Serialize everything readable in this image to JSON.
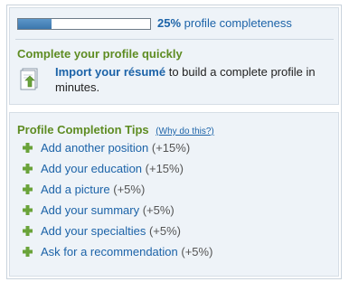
{
  "colors": {
    "link": "#1c63a8",
    "heading_green": "#5e8c22",
    "plus_green": "#6aa33a",
    "panel_bg": "#eef3f8",
    "progress_fill": "#3b77ad"
  },
  "progress": {
    "value_percent": 25,
    "percent_label": "25%",
    "suffix": "profile completeness"
  },
  "complete_profile": {
    "heading": "Complete your profile quickly",
    "link_text": "Import your résumé",
    "body_text": " to build a complete profile in minutes.",
    "icon": "import-resume-icon"
  },
  "tips": {
    "heading": "Profile Completion Tips",
    "why_link": "(Why do this?)",
    "icon": "plus-icon",
    "items": [
      {
        "label": "Add another position",
        "pct": "(+15%)"
      },
      {
        "label": "Add your education",
        "pct": "(+15%)"
      },
      {
        "label": "Add a picture",
        "pct": "(+5%)"
      },
      {
        "label": "Add your summary",
        "pct": "(+5%)"
      },
      {
        "label": "Add your specialties",
        "pct": "(+5%)"
      },
      {
        "label": "Ask for a recommendation",
        "pct": "(+5%)"
      }
    ]
  }
}
